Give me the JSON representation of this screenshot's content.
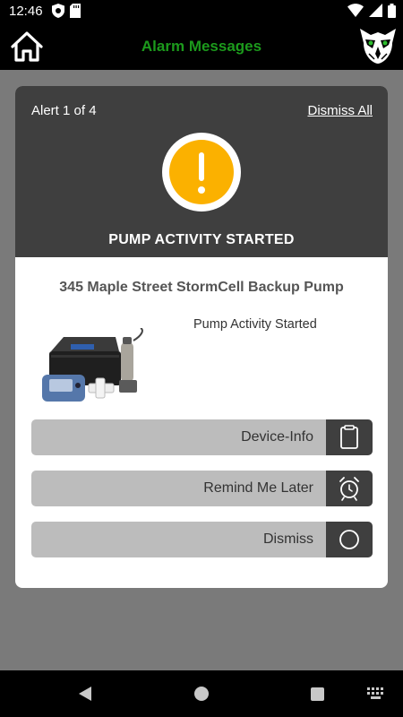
{
  "status_bar": {
    "time": "12:46"
  },
  "app_bar": {
    "title": "Alarm Messages"
  },
  "alert": {
    "counter": "Alert 1 of 4",
    "dismiss_all_label": "Dismiss All",
    "title": "PUMP ACTIVITY STARTED",
    "icon": "exclamation-icon",
    "icon_color": "#fbb100",
    "device_name": "345 Maple Street StormCell Backup Pump",
    "message": "Pump Activity Started"
  },
  "actions": [
    {
      "label": "Device-Info",
      "icon": "clipboard-icon"
    },
    {
      "label": "Remind Me Later",
      "icon": "alarm-clock-icon"
    },
    {
      "label": "Dismiss",
      "icon": "circle-icon"
    }
  ],
  "colors": {
    "accent_green": "#1c9a1c",
    "header_dark": "#3f3f3f",
    "button_gray": "#bcbcbc"
  }
}
